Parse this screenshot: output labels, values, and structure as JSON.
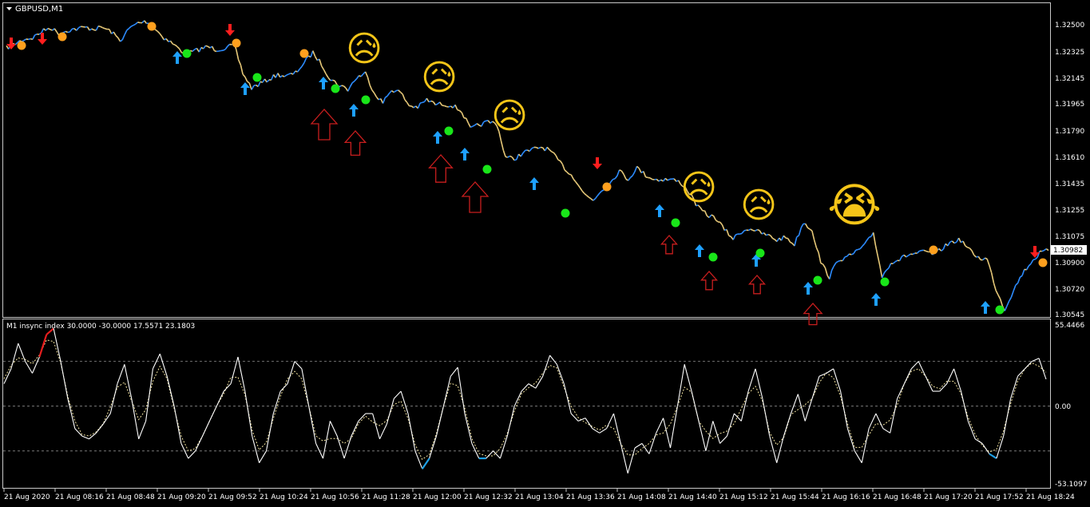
{
  "main_panel": {
    "title": "GBPUSD,M1",
    "price_ticks": [
      "1.32500",
      "1.32325",
      "1.32145",
      "1.31965",
      "1.31790",
      "1.31610",
      "1.31435",
      "1.31255",
      "1.31075",
      "1.30900",
      "1.30720",
      "1.30545"
    ],
    "current_price": "1.30982"
  },
  "indicator_panel": {
    "title": "M1 insync index 30.0000 -30.0000 17.5571 23.1803",
    "scale_labels": [
      "55.4466",
      "0.00",
      "-53.1097"
    ],
    "levels": {
      "upper": 30,
      "zero": 0,
      "lower": -30
    }
  },
  "time_labels": [
    "21 Aug 2020",
    "21 Aug 08:16",
    "21 Aug 08:48",
    "21 Aug 09:20",
    "21 Aug 09:52",
    "21 Aug 10:24",
    "21 Aug 10:56",
    "21 Aug 11:28",
    "21 Aug 12:00",
    "21 Aug 12:32",
    "21 Aug 13:04",
    "21 Aug 13:36",
    "21 Aug 14:08",
    "21 Aug 14:40",
    "21 Aug 15:12",
    "21 Aug 15:44",
    "21 Aug 16:16",
    "21 Aug 16:48",
    "21 Aug 17:20",
    "21 Aug 17:52",
    "21 Aug 18:24"
  ],
  "chart_data": [
    {
      "type": "line",
      "title": "GBPUSD,M1",
      "ylim": [
        1.30545,
        1.326
      ],
      "series": [
        {
          "values": [
            1.3235,
            1.3238,
            1.3241,
            1.3242,
            1.3246,
            1.3249,
            1.3245,
            1.3247,
            1.3248,
            1.3249,
            1.3248,
            1.3249,
            1.3246,
            1.324,
            1.3248,
            1.3252,
            1.3253,
            1.3248,
            1.3242,
            1.3238,
            1.3233,
            1.3232,
            1.3234,
            1.3236,
            1.3234,
            1.3235,
            1.3237,
            1.3218,
            1.3208,
            1.3211,
            1.3214,
            1.3217,
            1.3216,
            1.3218,
            1.3225,
            1.3232,
            1.3224,
            1.3214,
            1.321,
            1.3207,
            1.3215,
            1.3218,
            1.3205,
            1.3198,
            1.3207,
            1.3205,
            1.3196,
            1.3195,
            1.32,
            1.3197,
            1.3197,
            1.3196,
            1.3192,
            1.318,
            1.3183,
            1.3185,
            1.3184,
            1.3161,
            1.316,
            1.3164,
            1.3166,
            1.3168,
            1.3166,
            1.3159,
            1.3152,
            1.3146,
            1.3136,
            1.3132,
            1.3139,
            1.3144,
            1.3152,
            1.3146,
            1.3154,
            1.3149,
            1.3146,
            1.3146,
            1.3146,
            1.3144,
            1.3137,
            1.3127,
            1.3122,
            1.312,
            1.3112,
            1.3106,
            1.3111,
            1.3113,
            1.311,
            1.3108,
            1.3105,
            1.3107,
            1.3102,
            1.3117,
            1.3112,
            1.309,
            1.308,
            1.3092,
            1.3093,
            1.3097,
            1.3101,
            1.311,
            1.308,
            1.309,
            1.3092,
            1.3095,
            1.3096,
            1.3097,
            1.3095,
            1.31,
            1.3104,
            1.3105,
            1.3098,
            1.3093,
            1.3092,
            1.3072,
            1.3058,
            1.3071,
            1.3082,
            1.309,
            1.3096,
            1.3098
          ]
        }
      ]
    },
    {
      "type": "line",
      "title": "M1 insync index 30.0000 -30.0000 17.5571 23.1803",
      "ylim": [
        -53.1097,
        55.4466
      ],
      "series": [
        {
          "values": [
            15,
            25,
            42,
            30,
            22,
            33,
            48,
            52,
            30,
            5,
            -15,
            -20,
            -22,
            -18,
            -12,
            -5,
            15,
            28,
            5,
            -22,
            -10,
            25,
            35,
            20,
            0,
            -25,
            -35,
            -30,
            -20,
            -10,
            0,
            10,
            15,
            33,
            10,
            -20,
            -38,
            -30,
            -5,
            10,
            15,
            30,
            25,
            0,
            -25,
            -35,
            -10,
            -20,
            -35,
            -20,
            -10,
            -5,
            -5,
            -22,
            -12,
            5,
            10,
            -5,
            -30,
            -42,
            -35,
            -20,
            0,
            20,
            26,
            -5,
            -25,
            -35,
            -35,
            -30,
            -35,
            -20,
            0,
            10,
            15,
            12,
            20,
            34,
            28,
            15,
            -5,
            -10,
            -8,
            -15,
            -18,
            -15,
            -5,
            -25,
            -45,
            -28,
            -25,
            -32,
            -18,
            -8,
            -28,
            0,
            28,
            10,
            -10,
            -30,
            -10,
            -25,
            -20,
            -5,
            -10,
            10,
            25,
            5,
            -20,
            -38,
            -20,
            -5,
            8,
            -10,
            5,
            20,
            22,
            25,
            10,
            -15,
            -30,
            -38,
            -15,
            -5,
            -15,
            -18,
            5,
            15,
            25,
            30,
            20,
            10,
            10,
            15,
            25,
            10,
            -10,
            -22,
            -25,
            -32,
            -35,
            -20,
            5,
            20,
            25,
            30,
            32,
            18
          ]
        }
      ]
    }
  ],
  "markers": {
    "buy_arrow_color": "#1ea0ff",
    "sell_arrow_color": "#ff1e1e",
    "green_dot_color": "#19e619",
    "orange_dot_color": "#ffa01e",
    "outline_arrow_color": "#c81e1e"
  },
  "emojis": {
    "sad": "😥",
    "crying": "😭"
  }
}
